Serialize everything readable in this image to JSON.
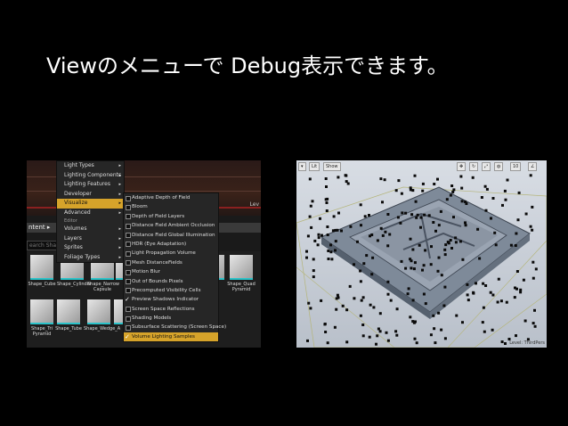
{
  "slide": {
    "title": "Viewのメニューで Debug表示できます。"
  },
  "left_shot": {
    "level_label": "Lev",
    "content_tab": "ntent",
    "search_placeholder": "earch Shap",
    "menu_items": [
      {
        "label": "Light Types",
        "arrow": "▸"
      },
      {
        "label": "Lighting Components",
        "arrow": "▸"
      },
      {
        "label": "Lighting Features",
        "arrow": "▸"
      },
      {
        "label": "Developer",
        "arrow": "▸"
      },
      {
        "label": "Visualize",
        "arrow": "▸",
        "highlighted": true
      },
      {
        "label": "Advanced",
        "arrow": "▸"
      },
      {
        "label": "Editor",
        "section": true
      },
      {
        "label": "Volumes",
        "arrow": "▸"
      },
      {
        "label": "Layers",
        "arrow": "▸"
      },
      {
        "label": "Sprites",
        "arrow": "▸"
      },
      {
        "label": "Foliage Types",
        "arrow": "▸"
      }
    ],
    "visualize_items": [
      {
        "label": "Adaptive Depth of Field",
        "checked": false
      },
      {
        "label": "Bloom",
        "checked": false
      },
      {
        "label": "Depth of Field Layers",
        "checked": false
      },
      {
        "label": "Distance Field Ambient Occlusion",
        "checked": false
      },
      {
        "label": "Distance Field Global Illumination",
        "checked": false
      },
      {
        "label": "HDR (Eye Adaptation)",
        "checked": false
      },
      {
        "label": "Light Propagation Volume",
        "checked": false
      },
      {
        "label": "Mesh DistanceFields",
        "checked": false
      },
      {
        "label": "Motion Blur",
        "checked": false
      },
      {
        "label": "Out of Bounds Pixels",
        "checked": false
      },
      {
        "label": "Precomputed Visibility Cells",
        "checked": false
      },
      {
        "label": "Preview Shadows Indicator",
        "checked": true
      },
      {
        "label": "Screen Space Reflections",
        "checked": false
      },
      {
        "label": "Shading Models",
        "checked": false
      },
      {
        "label": "Subsurface Scattering (Screen Space)",
        "checked": false
      },
      {
        "label": "Volume Lighting Samples",
        "checked": true,
        "highlighted": true
      }
    ],
    "assets_row1": [
      "Shape_Cube",
      "Shape_Cylinder",
      "Shape_Narrow Capsule",
      "Sh",
      "Plane",
      "Shape_Quad Pyramid"
    ],
    "assets_row2": [
      "Shape_Tri Pyramid",
      "Shape_Tube",
      "Shape_Wedge_A",
      "Sh"
    ]
  },
  "right_shot": {
    "lit_button": "Lit",
    "show_button": "Show",
    "toolbar_value": "10",
    "level_label": "Level: ThirdPers"
  },
  "colors": {
    "background": "#000000",
    "menu_highlight": "#d6a32a",
    "asset_accent": "#2ac2c8"
  }
}
